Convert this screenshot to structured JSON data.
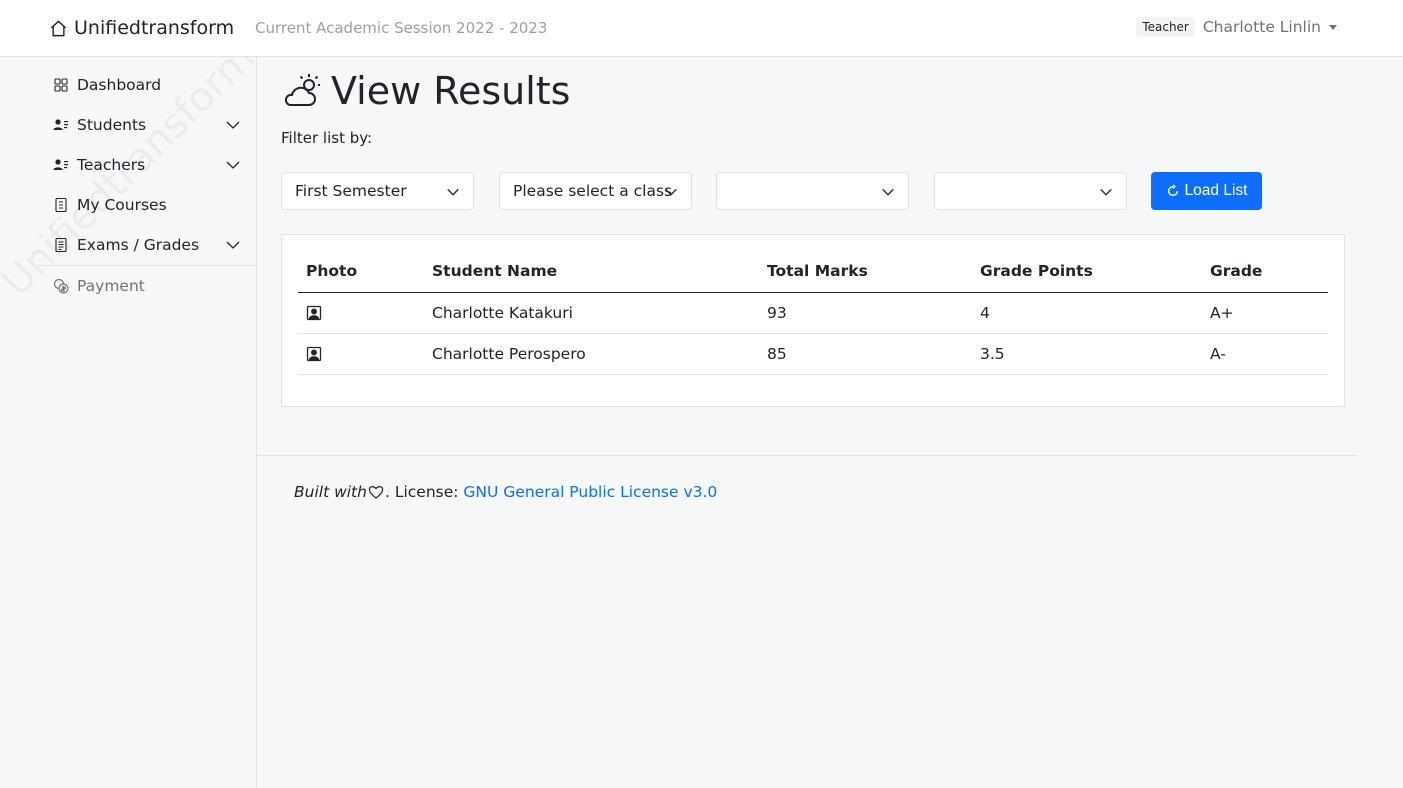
{
  "navbar": {
    "brand": "Unifiedtransform",
    "session": "Current Academic Session 2022 - 2023",
    "role_badge": "Teacher",
    "user_name": "Charlotte Linlin"
  },
  "sidebar": {
    "watermark": "Unifiedtransform",
    "items": [
      {
        "label": "Dashboard",
        "icon": "grid-icon"
      },
      {
        "label": "Students",
        "icon": "person-lines-icon",
        "expandable": true
      },
      {
        "label": "Teachers",
        "icon": "person-lines-icon",
        "expandable": true
      },
      {
        "label": "My Courses",
        "icon": "journal-icon"
      },
      {
        "label": "Exams / Grades",
        "icon": "file-text-icon",
        "expandable": true
      }
    ],
    "payment_label": "Payment"
  },
  "main": {
    "title": "View Results",
    "filter_label": "Filter list by:",
    "filters": {
      "semester": "First Semester",
      "class": "Please select a class",
      "section": "",
      "course": ""
    },
    "load_button": "Load List",
    "table": {
      "headers": [
        "Photo",
        "Student Name",
        "Total Marks",
        "Grade Points",
        "Grade"
      ],
      "rows": [
        {
          "name": "Charlotte Katakuri",
          "marks": "93",
          "points": "4",
          "grade": "A+"
        },
        {
          "name": "Charlotte Perospero",
          "marks": "85",
          "points": "3.5",
          "grade": "A-"
        }
      ]
    }
  },
  "footer": {
    "built_with": "Built with",
    "license_prefix": ". License: ",
    "license_link": "GNU General Public License v3.0"
  },
  "colors": {
    "accent": "#0d6efd",
    "background": "#f6f7f9"
  }
}
